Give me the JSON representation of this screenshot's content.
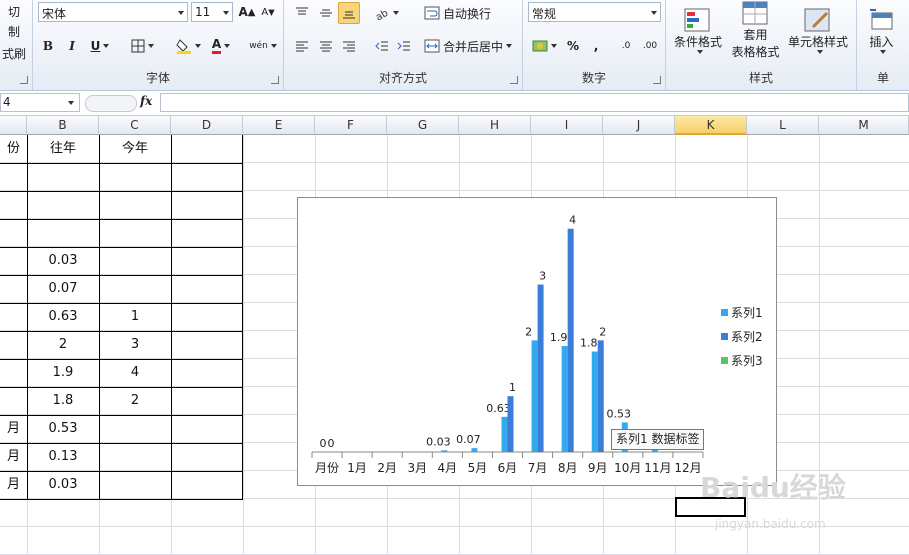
{
  "ribbon": {
    "clipboard": {
      "cut": "切",
      "copy": "制",
      "painter": "式刷"
    },
    "font": {
      "name": "宋体",
      "size": "11",
      "grow": "A",
      "shrink": "A",
      "bold": "B",
      "italic": "I",
      "underline": "U",
      "phonetic": "wén",
      "color_letter": "A",
      "group_label": "字体"
    },
    "align": {
      "wrap": "自动换行",
      "merge": "合并后居中",
      "group_label": "对齐方式"
    },
    "number": {
      "format": "常规",
      "percent": "%",
      "comma": ",",
      "inc": ".0",
      "dec": ".00",
      "group_label": "数字"
    },
    "styles": {
      "cond": "条件格式",
      "table": "套用",
      "table2": "表格格式",
      "cell": "单元格样式",
      "group_label": "样式"
    },
    "cells": {
      "insert": "插入",
      "group_label": "单"
    }
  },
  "formula_bar": {
    "name_box": "4",
    "fx": "fx",
    "value": ""
  },
  "columns": [
    "B",
    "C",
    "D",
    "E",
    "F",
    "G",
    "H",
    "I",
    "J",
    "K",
    "L",
    "M"
  ],
  "selected_column": "K",
  "table": {
    "col_a_header": "份",
    "col_b_header": "往年",
    "col_c_header": "今年",
    "rows": [
      {
        "a": "",
        "b": "",
        "c": ""
      },
      {
        "a": "",
        "b": "",
        "c": ""
      },
      {
        "a": "",
        "b": "",
        "c": ""
      },
      {
        "a": "",
        "b": "0.03",
        "c": ""
      },
      {
        "a": "",
        "b": "0.07",
        "c": ""
      },
      {
        "a": "",
        "b": "0.63",
        "c": "1"
      },
      {
        "a": "",
        "b": "2",
        "c": "3"
      },
      {
        "a": "",
        "b": "1.9",
        "c": "4"
      },
      {
        "a": "",
        "b": "1.8",
        "c": "2"
      },
      {
        "a": "月",
        "b": "0.53",
        "c": ""
      },
      {
        "a": "月",
        "b": "0.13",
        "c": ""
      },
      {
        "a": "月",
        "b": "0.03",
        "c": ""
      }
    ]
  },
  "chart_data": {
    "type": "bar",
    "categories": [
      "月份",
      "1月",
      "2月",
      "3月",
      "4月",
      "5月",
      "6月",
      "7月",
      "8月",
      "9月",
      "10月",
      "11月",
      "12月"
    ],
    "series": [
      {
        "name": "系列1",
        "color": "#33aaee",
        "values": [
          0,
          null,
          null,
          null,
          0.03,
          0.07,
          0.63,
          2,
          1.9,
          1.8,
          0.53,
          0.13,
          null
        ]
      },
      {
        "name": "系列2",
        "color": "#3b7dd8",
        "values": [
          0,
          null,
          null,
          null,
          null,
          null,
          1,
          3,
          4,
          2,
          null,
          null,
          null
        ]
      },
      {
        "name": "系列3",
        "color": "#55c465",
        "values": [
          null,
          null,
          null,
          null,
          null,
          null,
          null,
          null,
          null,
          null,
          null,
          null,
          null
        ]
      }
    ],
    "data_labels": {
      "s1": [
        "0",
        "",
        "",
        "",
        "0.03",
        "0.07",
        "0.63",
        "2",
        "1.9",
        "1.8",
        "0.53",
        "0.13",
        ""
      ],
      "s2": [
        "0",
        "",
        "",
        "",
        "",
        "",
        "1",
        "3",
        "4",
        "2",
        "",
        "",
        ""
      ]
    },
    "ylim": [
      0,
      4.3
    ],
    "legend": "right"
  },
  "tooltip": "系列1 数据标签",
  "watermark": {
    "brand": "Baidu经验",
    "url": "jingyan.baidu.com"
  }
}
